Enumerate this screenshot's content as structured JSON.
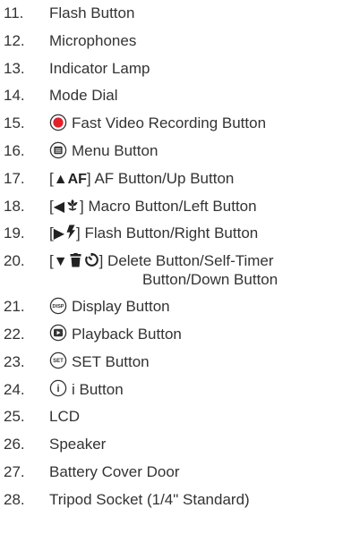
{
  "colors": {
    "text": "#333333",
    "record_red": "#e0202a",
    "icon_dark": "#333333"
  },
  "items": [
    {
      "num": "11.",
      "label": "Flash Button"
    },
    {
      "num": "12.",
      "label": "Microphones"
    },
    {
      "num": "13.",
      "label": "Indicator Lamp"
    },
    {
      "num": "14.",
      "label": "Mode Dial"
    },
    {
      "num": "15.",
      "label": "Fast Video Recording Button",
      "icon": "record-dot-icon"
    },
    {
      "num": "16.",
      "label": "Menu Button",
      "icon": "menu-icon"
    },
    {
      "num": "17.",
      "bracket_open": "[",
      "glyph": "▲AF",
      "bracket_close": "]",
      "label": "AF Button/Up Button"
    },
    {
      "num": "18.",
      "bracket_open": "[",
      "glyph": "◀",
      "bracket_close": "]",
      "label": "Macro Button/Left Button",
      "glyph_icon": "macro-flower-icon"
    },
    {
      "num": "19.",
      "bracket_open": "[",
      "glyph": "▶",
      "bracket_close": "]",
      "label": "Flash Button/Right Button",
      "glyph_icon": "flash-bolt-icon"
    },
    {
      "num": "20.",
      "bracket_open": "[",
      "glyph": "▼",
      "bracket_close": "]",
      "label": "Delete Button/Self-Timer",
      "label_cont": "Button/Down Button",
      "glyph_icon": "trash-timer-icon"
    },
    {
      "num": "21.",
      "label": "Display Button",
      "icon": "disp-icon",
      "icon_text": "DISP"
    },
    {
      "num": "22.",
      "label": "Playback Button",
      "icon": "playback-icon"
    },
    {
      "num": "23.",
      "label": "SET Button",
      "icon": "set-icon",
      "icon_text": "SET"
    },
    {
      "num": "24.",
      "label": "i Button",
      "icon": "i-icon",
      "icon_text": "i"
    },
    {
      "num": "25.",
      "label": "LCD"
    },
    {
      "num": "26.",
      "label": "Speaker"
    },
    {
      "num": "27.",
      "label": "Battery Cover Door"
    },
    {
      "num": "28.",
      "label": "Tripod Socket (1/4\" Standard)"
    }
  ]
}
